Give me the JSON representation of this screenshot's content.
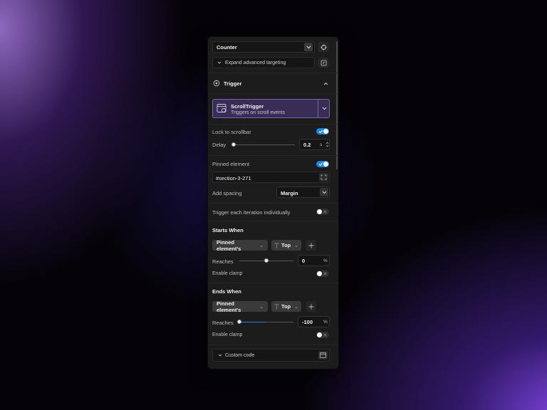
{
  "target": {
    "selected": "Counter",
    "expand_label": "Expand advanced targeting"
  },
  "trigger": {
    "section_title": "Trigger",
    "selected_name": "ScrollTrigger",
    "selected_desc": "Triggers on scroll events",
    "lock_label": "Lock to scrollbar",
    "lock_on": true,
    "delay_label": "Delay",
    "delay_value": "0.2",
    "delay_unit": "s",
    "delay_fraction": 0.0,
    "pinned_label": "Pinned element",
    "pinned_on": true,
    "pinned_value": "#section-3-271",
    "spacing_label": "Add spacing",
    "spacing_value": "Margin",
    "each_iteration_label": "Trigger each iteration individually",
    "each_iteration_on": false
  },
  "starts": {
    "title": "Starts When",
    "element": "Pinned element's",
    "position": "Top",
    "reaches_label": "Reaches",
    "reaches_value": "0",
    "unit": "%",
    "slider_fraction": 0.5,
    "clamp_label": "Enable clamp",
    "clamp_on": false
  },
  "ends": {
    "title": "Ends When",
    "element": "Pinned element's",
    "position": "Top",
    "reaches_label": "Reaches",
    "reaches_value": "-100",
    "unit": "%",
    "slider_fraction": 0.0,
    "clamp_label": "Enable clamp",
    "clamp_on": false
  },
  "custom_code": {
    "label": "Custom code"
  },
  "colors": {
    "accent": "#1a84e0",
    "trigger_card": "#3a2d55",
    "trigger_border": "#7a64b0"
  }
}
